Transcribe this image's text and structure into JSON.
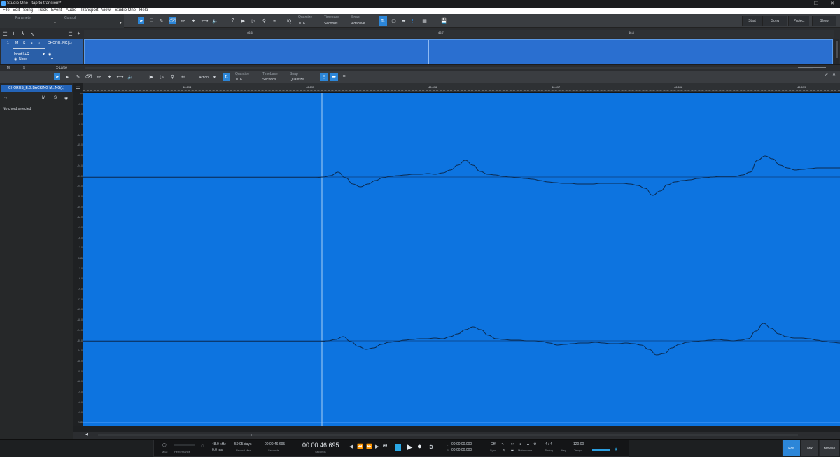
{
  "window": {
    "title": "Studio One - tap to transient*"
  },
  "menu": [
    "File",
    "Edit",
    "Song",
    "Track",
    "Event",
    "Audio",
    "Transport",
    "View",
    "Studio One",
    "Help"
  ],
  "toolbar": {
    "parameter_label": "Parameter",
    "control_label": "Control",
    "quantize_label": "Quantize",
    "quantize_value": "1/16",
    "timebase_label": "Timebase",
    "timebase_value": "Seconds",
    "snap_label": "Snap",
    "snap_value": "Adaptive",
    "iq_label": "IQ",
    "nav": {
      "start": "Start",
      "song": "Song",
      "project": "Project",
      "show": "Show"
    }
  },
  "track": {
    "number": "1",
    "mute": "M",
    "solo": "S",
    "name": "CHORU..NG(L)",
    "input": "Input L+R",
    "output": "None",
    "size_label": "X-Large",
    "m_label": "M",
    "s_label": "S"
  },
  "ruler1": {
    "ticks": [
      "46.6",
      "46.7",
      "46.8"
    ]
  },
  "editor": {
    "action_label": "Action",
    "quantize_label": "Quantize",
    "quantize_value": "1/16",
    "timebase_label": "Timebase",
    "timebase_value": "Seconds",
    "snap_label": "Snap",
    "snap_value": "Quantize",
    "track_name": "CHORUS_E.G.BACKING M...NG(L)",
    "no_chord": "No chord selected",
    "m": "M",
    "s": "S",
    "ruler_ticks": [
      "46.694",
      "46.695",
      "46.696",
      "46.697",
      "46.698",
      "46.699"
    ],
    "scale_ticks": [
      "-oo",
      "-3.0",
      "-6.0",
      "-9.0",
      "-12.0",
      "-15.0",
      "-18.0",
      "-24.0",
      "-30.0",
      "-24.0",
      "-18.0",
      "-15.0",
      "-12.0",
      "-9.0",
      "-6.0",
      "-3.0",
      "0dB",
      "-3.0",
      "-6.0",
      "-9.0",
      "-12.0",
      "-15.0",
      "-18.0",
      "-24.0",
      "-30.0",
      "-24.0",
      "-18.0",
      "-15.0",
      "-12.0",
      "-9.0",
      "-6.0",
      "-3.0",
      "0dB"
    ]
  },
  "transport": {
    "midi": "MIDI",
    "performance": "Performance",
    "sample_rate": "48.0 kHz",
    "latency": "0.0 ms",
    "record_days": "59:05 days",
    "record_max": "Record Max",
    "position_small": "00:00:46.695",
    "seconds_label": "Seconds",
    "main_time": "00:00:46.695",
    "main_sub": "Seconds",
    "loop_l": "00:00:00.000",
    "loop_r": "00:00:00.000",
    "l_label": "L",
    "r_label": "R",
    "sync_value": "Off",
    "sync_label": "Sync",
    "metronome_label": "Metronome",
    "timing_value": "4 / 4",
    "timing_label": "Timing",
    "key_label": "Key",
    "tempo_value": "120.00",
    "tempo_label": "Tempo"
  },
  "tabs": {
    "edit": "Edit",
    "mix": "Mix",
    "browse": "Browse"
  },
  "colors": {
    "waveform_bg": "#0d74e0",
    "accent": "#2c86d8",
    "clip": "#2a6fd0"
  },
  "waveform": {
    "channels": [
      [
        -1,
        -1,
        -1,
        -1,
        -1,
        -1,
        -1,
        -1,
        -1,
        -1,
        -1,
        -1,
        -1,
        -1,
        -1,
        -1,
        -1,
        -1,
        -1,
        -1,
        -1,
        -1,
        -1,
        -1,
        -1,
        -1,
        -1,
        -1,
        -1,
        -1,
        -1,
        -1,
        0,
        2,
        7,
        -1,
        -10,
        -14,
        -10,
        -5,
        -1,
        1,
        2,
        3,
        4,
        4,
        5,
        4,
        6,
        10,
        17,
        24,
        17,
        8,
        4,
        3,
        1,
        0,
        -1,
        -2,
        -3,
        -5,
        -7,
        -8,
        -9,
        -9,
        -10,
        -10,
        -10,
        -9,
        -9,
        -9,
        -9,
        -10,
        -12,
        -16,
        -26,
        -20,
        -11,
        -7,
        -5,
        -4,
        -2,
        -1,
        0,
        1,
        1,
        1,
        3,
        7,
        24,
        30,
        26,
        17,
        13,
        10,
        11,
        12,
        13,
        13,
        13,
        13
      ],
      [
        -1,
        -1,
        -1,
        -1,
        -1,
        -1,
        -1,
        -1,
        -1,
        -1,
        -1,
        -1,
        -1,
        -1,
        -1,
        -1,
        -1,
        -1,
        -1,
        -1,
        -1,
        -1,
        -1,
        -1,
        -1,
        -1,
        -1,
        -1,
        -1,
        -1,
        -1,
        -1,
        0,
        2,
        6,
        -1,
        -8,
        -12,
        -10,
        -5,
        -2,
        -1,
        1,
        2,
        3,
        3,
        4,
        3,
        6,
        10,
        16,
        20,
        16,
        8,
        3,
        2,
        1,
        1,
        0,
        0,
        -1,
        -3,
        -6,
        -5,
        -4,
        -3,
        -3,
        -2,
        -3,
        -4,
        -4,
        -3,
        -4,
        -6,
        -12,
        -20,
        -18,
        -10,
        -5,
        -2,
        -1,
        0,
        1,
        2,
        1,
        0,
        1,
        3,
        14,
        25,
        18,
        10,
        6,
        4,
        4,
        3,
        1,
        -1,
        -2,
        -3
      ]
    ]
  }
}
